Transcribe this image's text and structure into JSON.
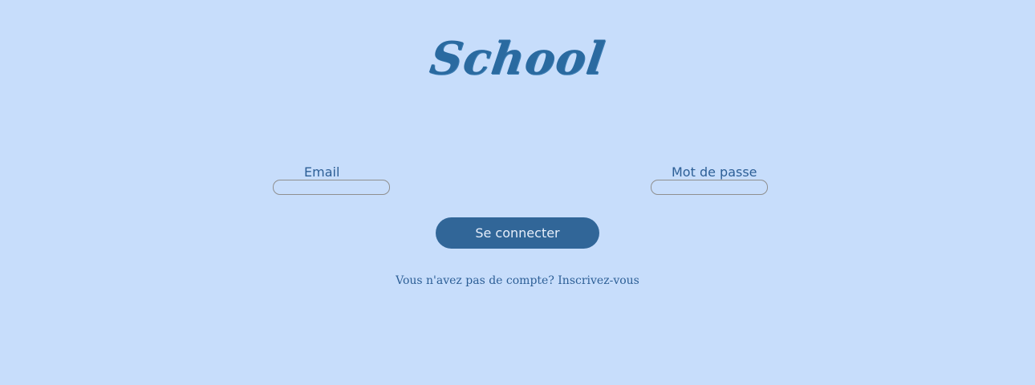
{
  "logo": {
    "text": "School"
  },
  "form": {
    "email_label": "Email",
    "email_value": "",
    "password_label": "Mot de passe",
    "password_value": "",
    "submit_label": "Se connecter"
  },
  "signup": {
    "prompt": "Vous n'avez pas de compte?",
    "link": "Inscrivez-vous"
  },
  "colors": {
    "background": "#c7ddfb",
    "accent": "#316698",
    "text": "#2d5f96"
  }
}
